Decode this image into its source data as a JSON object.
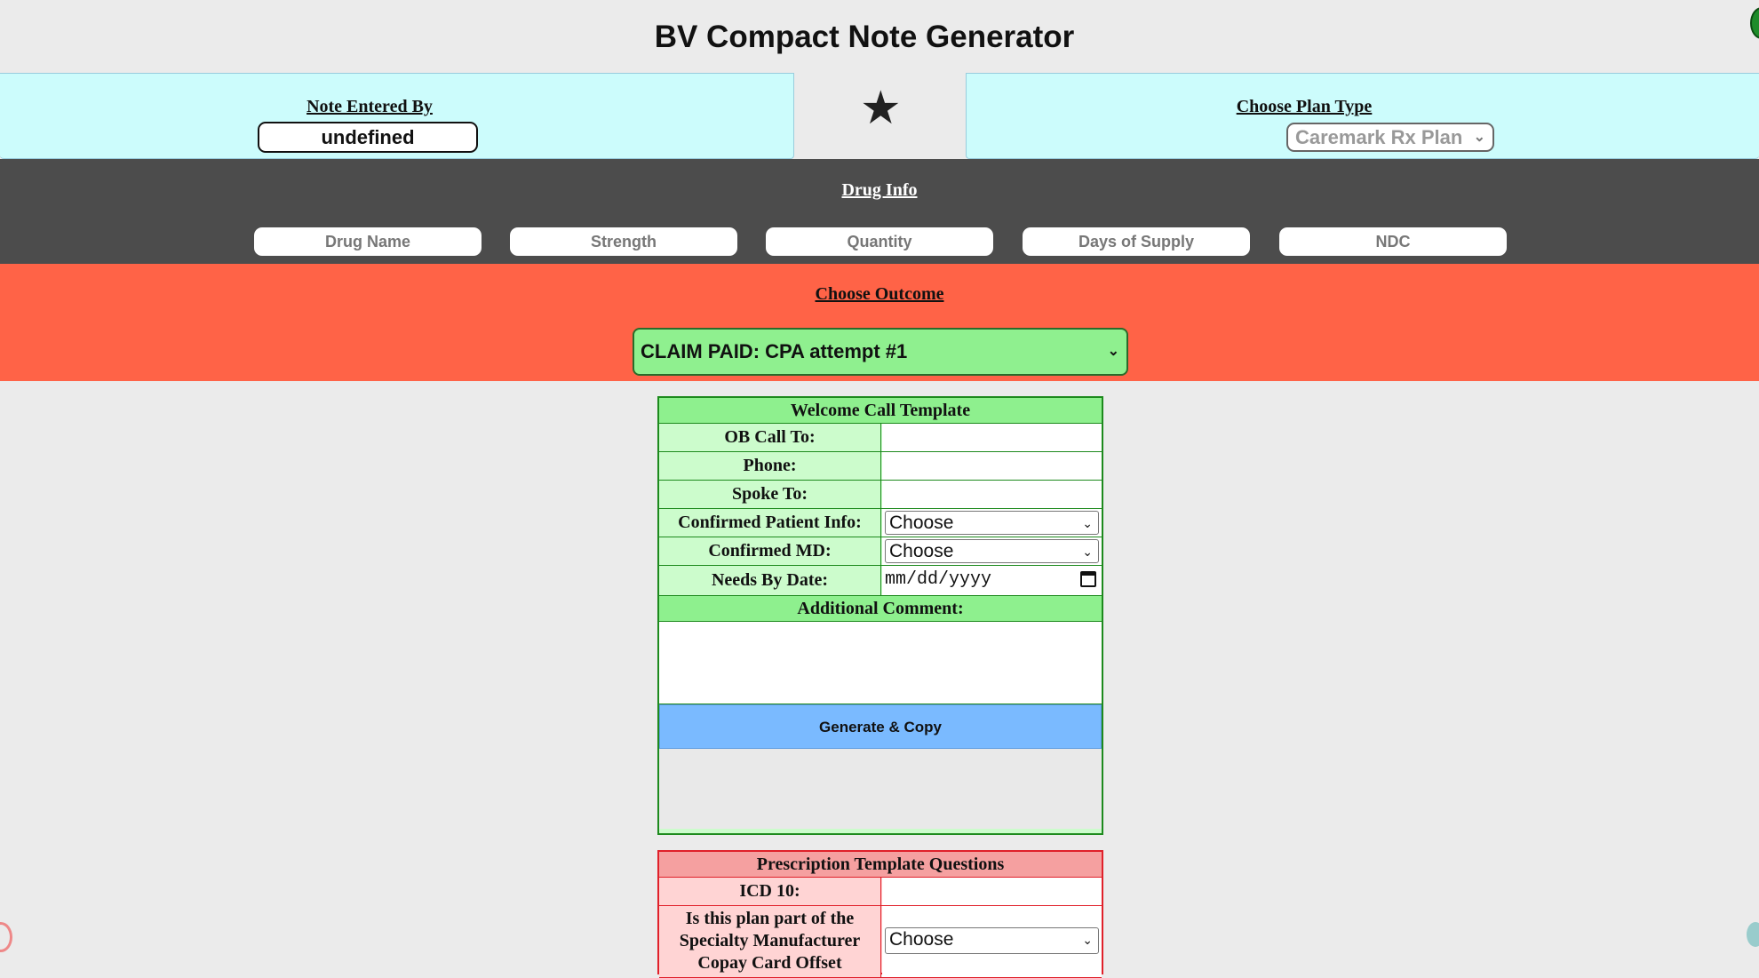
{
  "app": {
    "title": "BV Compact Note Generator"
  },
  "header": {
    "note_entered_by_label": "Note Entered By",
    "note_entered_by_value": "undefined",
    "star_glyph": "★",
    "plan_type_label": "Choose Plan Type",
    "plan_type_value": "Caremark Rx Plan"
  },
  "drug_info": {
    "label": "Drug Info",
    "fields": {
      "drug_name": "Drug Name",
      "strength": "Strength",
      "quantity": "Quantity",
      "days_of_supply": "Days of Supply",
      "ndc": "NDC"
    }
  },
  "outcome": {
    "label": "Choose Outcome",
    "value": "CLAIM PAID: CPA attempt #1"
  },
  "welcome_template": {
    "title": "Welcome Call Template",
    "rows": {
      "ob_call_to": "OB Call To:",
      "phone": "Phone:",
      "spoke_to": "Spoke To:",
      "confirmed_patient_info": "Confirmed Patient Info:",
      "confirmed_md": "Confirmed MD:",
      "needs_by_date": "Needs By Date:"
    },
    "select_default": "Choose",
    "date_placeholder": "mm/dd/yyyy",
    "additional_comment_label": "Additional Comment:",
    "generate_button": "Generate & Copy"
  },
  "prescription_template": {
    "title": "Prescription Template Questions",
    "icd10_label": "ICD 10:",
    "specialty_question": "Is this plan part of the Specialty Manufacturer Copay Card Offset",
    "select_default": "Choose"
  },
  "colors": {
    "header_panel": "#ccfcfc",
    "drug_bar": "#4c4c4c",
    "outcome_bar": "#ff6347",
    "welcome_accent": "#8ef08e",
    "generate_button": "#7abaff",
    "rx_accent": "#f5a0a0"
  },
  "icons": {
    "star": "star-icon",
    "calendar": "calendar-icon",
    "dropdown": "chevron-down-icon"
  }
}
